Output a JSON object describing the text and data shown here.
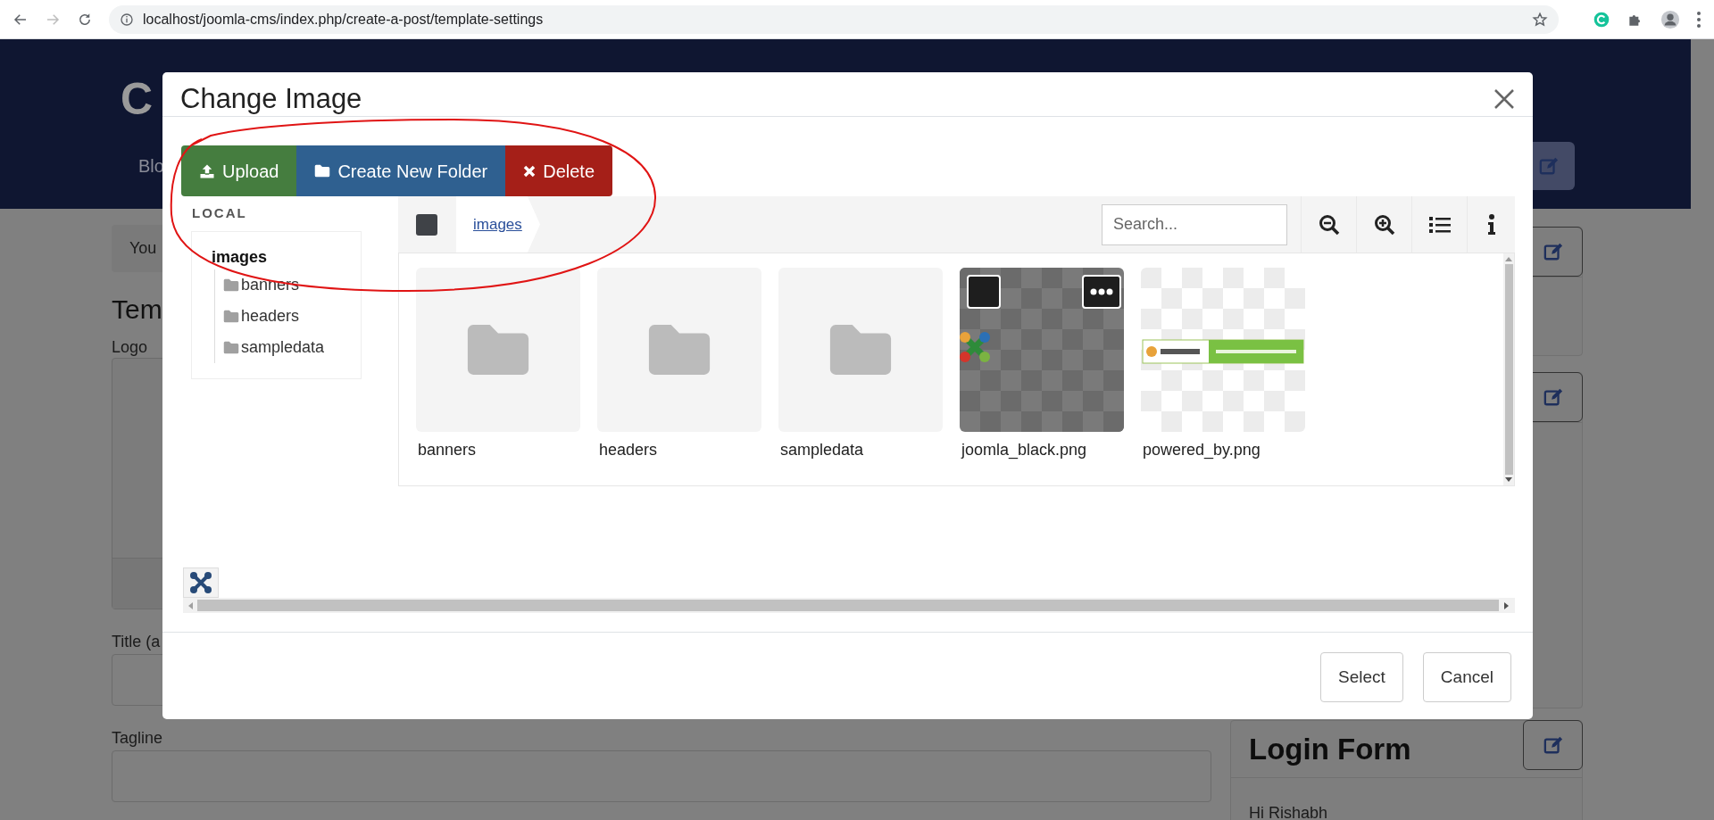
{
  "browser": {
    "url": "localhost/joomla-cms/index.php/create-a-post/template-settings"
  },
  "page": {
    "logo_text": "C",
    "nav_item": "Blo",
    "breadcrumb": "You",
    "heading": "Tem",
    "fields": [
      {
        "label": "Logo"
      },
      {
        "label": "Title (a",
        "kind": "text"
      },
      {
        "label": "Tagline",
        "kind": "text"
      }
    ],
    "cards": [
      {
        "kind": "plain"
      },
      {
        "kind": "plain"
      },
      {
        "kind": "login",
        "title": "Login Form",
        "greeting": "Hi Rishabh"
      }
    ]
  },
  "modal": {
    "title": "Change Image",
    "toolbar": [
      {
        "label": "Upload",
        "kind": "upload"
      },
      {
        "label": "Create New Folder",
        "kind": "folder"
      },
      {
        "label": "Delete",
        "kind": "delete"
      }
    ],
    "tree": {
      "heading": "LOCAL",
      "root": {
        "label": "images",
        "selected": true,
        "children": [
          {
            "label": "banners",
            "selected": false
          },
          {
            "label": "headers",
            "selected": false
          },
          {
            "label": "sampledata",
            "selected": false
          }
        ]
      }
    },
    "select_all": {
      "checked": false
    },
    "breadcrumb": "images",
    "search": {
      "placeholder": "Search..."
    },
    "items": [
      {
        "name": "banners",
        "kind": "folder",
        "hovered": false
      },
      {
        "name": "headers",
        "kind": "folder",
        "hovered": false
      },
      {
        "name": "sampledata",
        "kind": "folder",
        "hovered": false
      },
      {
        "name": "joomla_black.png",
        "hovered": true
      },
      {
        "name": "powered_by.png",
        "hovered": false
      }
    ],
    "buttons": [
      "Select",
      "Cancel"
    ]
  }
}
